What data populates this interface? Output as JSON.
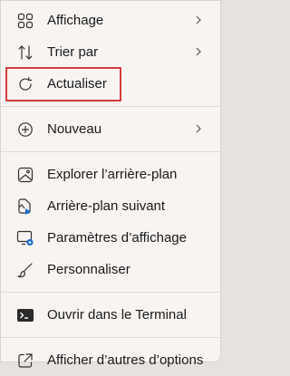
{
  "menu": {
    "items": [
      {
        "label": "Affichage",
        "icon": "grid-icon",
        "submenu": true
      },
      {
        "label": "Trier par",
        "icon": "sort-icon",
        "submenu": true
      },
      {
        "label": "Actualiser",
        "icon": "refresh-icon",
        "submenu": false,
        "highlighted": true
      },
      {
        "label": "Nouveau",
        "icon": "plus-circle-icon",
        "submenu": true
      },
      {
        "label": "Explorer l’arrière-plan",
        "icon": "image-icon",
        "submenu": false
      },
      {
        "label": "Arrière-plan suivant",
        "icon": "next-background-icon",
        "submenu": false
      },
      {
        "label": "Paramètres d’affichage",
        "icon": "display-settings-icon",
        "submenu": false
      },
      {
        "label": "Personnaliser",
        "icon": "brush-icon",
        "submenu": false
      },
      {
        "label": "Ouvrir dans le Terminal",
        "icon": "terminal-icon",
        "submenu": false
      },
      {
        "label": "Afficher d’autres d’options",
        "icon": "more-options-icon",
        "submenu": false
      }
    ]
  },
  "colors": {
    "menu_bg": "#f7f4f2",
    "highlight_border": "#d63b3b",
    "text": "#1b1b1b"
  }
}
